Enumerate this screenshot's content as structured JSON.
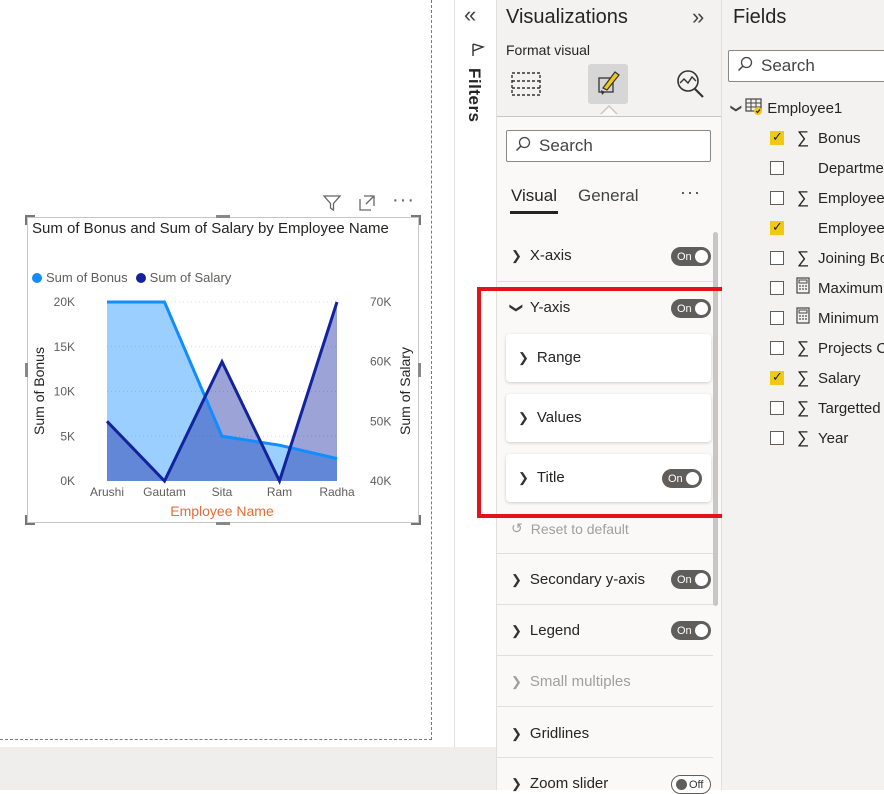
{
  "visual": {
    "title": "Sum of Bonus and Sum of Salary by Employee Name",
    "legend": [
      {
        "label": "Sum of Bonus",
        "color": "#118dff"
      },
      {
        "label": "Sum of Salary",
        "color": "#12239e"
      }
    ]
  },
  "chart_data": {
    "type": "area",
    "title": "Sum of Bonus and Sum of Salary by Employee Name",
    "xlabel": "Employee Name",
    "categories": [
      "Arushi",
      "Gautam",
      "Sita",
      "Ram",
      "Radha"
    ],
    "series": [
      {
        "name": "Sum of Bonus",
        "axis": "left",
        "values": [
          20000,
          20000,
          5000,
          4000,
          2500
        ],
        "color": "#118dff"
      },
      {
        "name": "Sum of Salary",
        "axis": "right",
        "values": [
          50000,
          40000,
          60000,
          40000,
          70000
        ],
        "color": "#12239e"
      }
    ],
    "ylabel": "Sum of Bonus",
    "ylim": [
      0,
      20000
    ],
    "yticks": [
      "0K",
      "5K",
      "10K",
      "15K",
      "20K"
    ],
    "y2label": "Sum of Salary",
    "y2lim": [
      40000,
      70000
    ],
    "y2ticks": [
      "40K",
      "50K",
      "60K",
      "70K"
    ],
    "grid": true,
    "legend_position": "top-left"
  },
  "filters": {
    "label": "Filters"
  },
  "viz": {
    "title": "Visualizations",
    "format_label": "Format visual",
    "search_placeholder": "Search",
    "tabs": {
      "visual": "Visual",
      "general": "General",
      "more": "···"
    },
    "sections": {
      "x_axis": {
        "label": "X-axis",
        "toggle": "On"
      },
      "y_axis": {
        "label": "Y-axis",
        "toggle": "On"
      },
      "range": {
        "label": "Range"
      },
      "values": {
        "label": "Values"
      },
      "title": {
        "label": "Title",
        "toggle": "On"
      },
      "reset": {
        "label": "Reset to default"
      },
      "secondary": {
        "label": "Secondary y-axis",
        "toggle": "On"
      },
      "legend": {
        "label": "Legend",
        "toggle": "On"
      },
      "small_multiples": {
        "label": "Small multiples"
      },
      "gridlines": {
        "label": "Gridlines"
      },
      "zoom": {
        "label": "Zoom slider",
        "toggle": "Off"
      }
    }
  },
  "fields": {
    "title": "Fields",
    "search_placeholder": "Search",
    "table": "Employee1",
    "items": [
      {
        "label": "Bonus",
        "checked": true,
        "icon": "sigma"
      },
      {
        "label": "Departme",
        "checked": false,
        "icon": "none"
      },
      {
        "label": "Employee",
        "checked": false,
        "icon": "sigma"
      },
      {
        "label": "Employee",
        "checked": true,
        "icon": "none"
      },
      {
        "label": "Joining Bo",
        "checked": false,
        "icon": "sigma"
      },
      {
        "label": "Maximum",
        "checked": false,
        "icon": "calculator"
      },
      {
        "label": "Minimum",
        "checked": false,
        "icon": "calculator"
      },
      {
        "label": "Projects Co",
        "checked": false,
        "icon": "sigma"
      },
      {
        "label": "Salary",
        "checked": true,
        "icon": "sigma"
      },
      {
        "label": "Targetted",
        "checked": false,
        "icon": "sigma"
      },
      {
        "label": "Year",
        "checked": false,
        "icon": "sigma"
      }
    ]
  }
}
